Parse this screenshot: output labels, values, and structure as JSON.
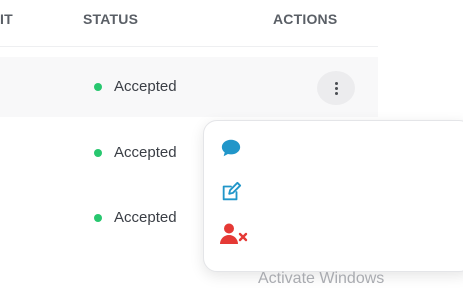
{
  "table": {
    "columns": {
      "partial": "IT",
      "status": "STATUS",
      "actions": "ACTIONS"
    },
    "rows": [
      {
        "status": "Accepted"
      },
      {
        "status": "Accepted"
      },
      {
        "status": "Accepted"
      }
    ]
  },
  "status_color": "#28c76f",
  "actions_menu": {
    "items": [
      {
        "icon": "chat-bubble-icon",
        "color": "#2196c9"
      },
      {
        "icon": "edit-icon",
        "color": "#2196c9"
      },
      {
        "icon": "remove-user-icon",
        "color": "#e53935"
      }
    ]
  },
  "watermark": {
    "text": "Activate Windows"
  }
}
